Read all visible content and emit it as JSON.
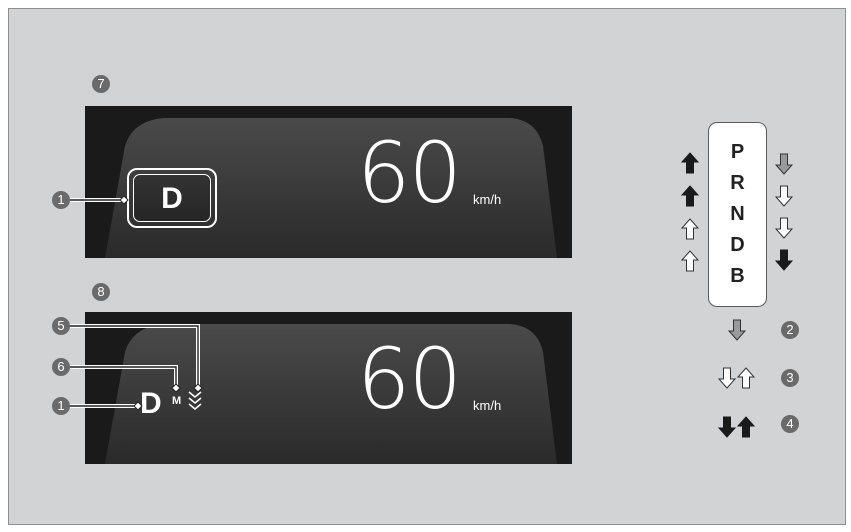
{
  "figure_label_top": "7",
  "figure_label_bottom": "8",
  "top_display": {
    "speed": "60",
    "unit": "km/h",
    "gear": "D",
    "callout": "1"
  },
  "bottom_display": {
    "speed": "60",
    "unit": "km/h",
    "gear": "D",
    "mode": "M",
    "callouts": {
      "deceleration_indicator": "5",
      "mode_indicator": "6",
      "gear": "1"
    }
  },
  "shift_column": {
    "positions": [
      "P",
      "R",
      "N",
      "D",
      "B"
    ]
  },
  "legend": [
    {
      "number": "2",
      "arrows": [
        "down-gray"
      ]
    },
    {
      "number": "3",
      "arrows": [
        "down-outline",
        "up-outline"
      ]
    },
    {
      "number": "4",
      "arrows": [
        "down-black",
        "up-black"
      ]
    }
  ],
  "colors": {
    "background": "#d2d3d5",
    "display": "#1a1a1a",
    "callout_badge": "#6a6a6a",
    "arrow_gray": "#9a9a9a",
    "arrow_black": "#1a1a1a"
  }
}
